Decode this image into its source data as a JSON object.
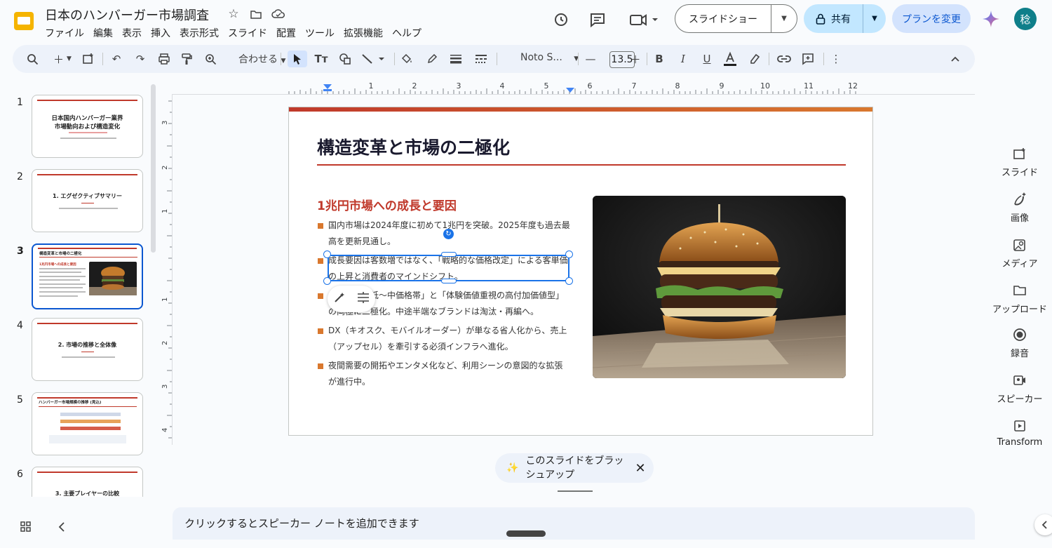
{
  "header": {
    "title": "日本のハンバーガー市場調査",
    "menu": [
      "ファイル",
      "編集",
      "表示",
      "挿入",
      "表示形式",
      "スライド",
      "配置",
      "ツール",
      "拡張機能",
      "ヘルプ"
    ],
    "slideshow_label": "スライドショー",
    "share_label": "共有",
    "plan_label": "プランを変更",
    "avatar_initial": "稔"
  },
  "toolbar": {
    "zoom_label": "合わせる",
    "font_label": "Noto S...",
    "font_size": "13.5"
  },
  "filmstrip": {
    "slides": [
      {
        "num": "1",
        "title_line1": "日本国内ハンバーガー業界",
        "title_line2": "市場動向および構造変化"
      },
      {
        "num": "2",
        "title": "1. エグゼクティブサマリー"
      },
      {
        "num": "3",
        "title": "構造変革と市場の二極化",
        "sub": "1兆円市場への成長と要因"
      },
      {
        "num": "4",
        "title": "2. 市場の推移と全体像"
      },
      {
        "num": "5",
        "title": "ハンバーガー市場規模の推移 (見込)"
      },
      {
        "num": "6",
        "title": "3. 主要プレイヤーの比較"
      }
    ]
  },
  "ruler": {
    "h_labels": [
      "1",
      "2",
      "3",
      "4",
      "5",
      "6",
      "7",
      "8",
      "9",
      "10",
      "11",
      "12"
    ],
    "v_labels": [
      "3",
      "2",
      "1",
      "1",
      "2",
      "3",
      "4"
    ]
  },
  "slide": {
    "title": "構造変革と市場の二極化",
    "subtitle": "1兆円市場への成長と要因",
    "bullets": [
      "国内市場は2024年度に初めて1兆円を突破。2025年度も過去最高を更新見通し。",
      "成長要因は客数増ではなく、「戦略的な価格改定」による客単価の上昇と消費者のマインドシフト。",
      "低価格帯の低〜中価格帯」と「体験価値重視の高付加価値型」の両極に二極化。中途半端なブランドは淘汰・再編へ。",
      "DX（キオスク、モバイルオーダー）が単なる省人化から、売上（アップセル）を牽引する必須インフラへ進化。",
      "夜間需要の開拓やエンタメ化など、利用シーンの意図的な拡張が進行中。"
    ]
  },
  "side_panel": {
    "items": [
      "スライド",
      "画像",
      "メディア",
      "アップロード",
      "録音",
      "スピーカー",
      "Transform"
    ]
  },
  "bottom": {
    "brush_label": "このスライドをブラッシュアップ",
    "notes_placeholder": "クリックするとスピーカー ノートを追加できます"
  },
  "colors": {
    "accent": "#c0392b",
    "accent2": "#d9782e",
    "selection": "#1a73e8"
  }
}
